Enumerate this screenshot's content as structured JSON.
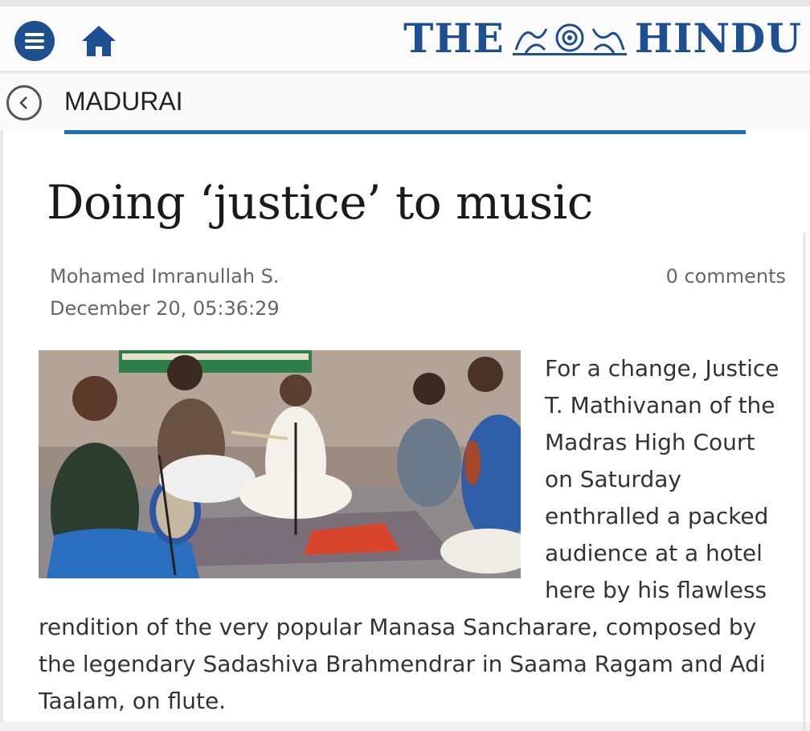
{
  "header": {
    "logo_left": "THE",
    "logo_right": "HINDU",
    "brand_color": "#1d4f91"
  },
  "section": {
    "title": "MADURAI",
    "accent_color": "#1f6fb3"
  },
  "article": {
    "headline": "Doing ‘justice’ to music",
    "author": "Mohamed Imranullah S.",
    "date": "December 20, 05:36:29",
    "comments": "0 comments",
    "body": "For a change, Justice T. Mathivanan of the Madras High Court on Saturday enthralled a packed audience at a hotel here by his flawless rendition of the very popular Manasa Sancharare, composed by the legendary Sadashiva Brahmendrar in Saama Ragam and Adi Taalam, on flute."
  },
  "icons": {
    "menu": "menu-icon",
    "home": "home-icon",
    "back": "back-chevron-icon"
  }
}
